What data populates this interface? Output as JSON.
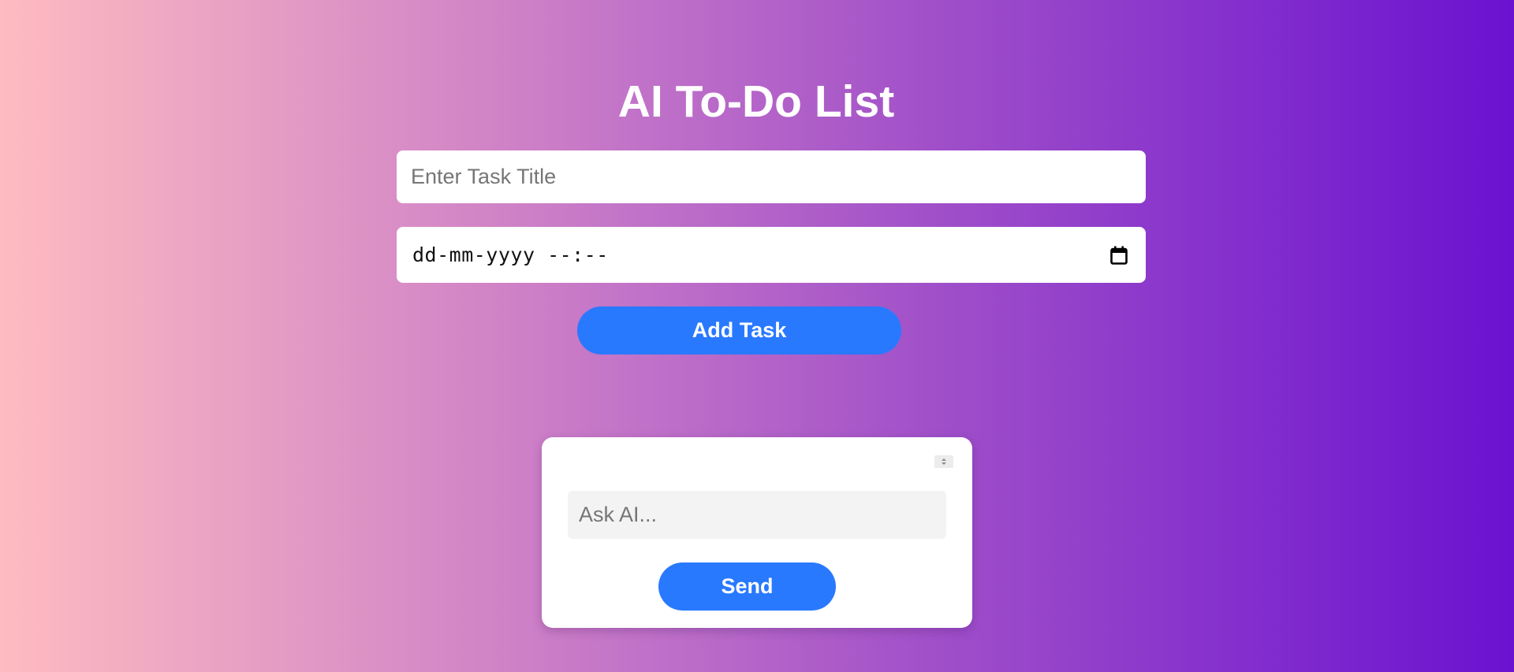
{
  "app": {
    "title": "AI To-Do List"
  },
  "task_form": {
    "title_input": {
      "placeholder": "Enter Task Title",
      "value": ""
    },
    "datetime_input": {
      "display": "dd-mm-yyyy --:--",
      "icon": "calendar-icon"
    },
    "add_button_label": "Add Task"
  },
  "chat": {
    "resize_icon": "resize-handle-icon",
    "ask_input": {
      "placeholder": "Ask AI...",
      "value": ""
    },
    "send_button_label": "Send"
  },
  "colors": {
    "accent": "#2979ff",
    "gradient_start": "#ffbbc1",
    "gradient_end": "#6a12d0"
  }
}
